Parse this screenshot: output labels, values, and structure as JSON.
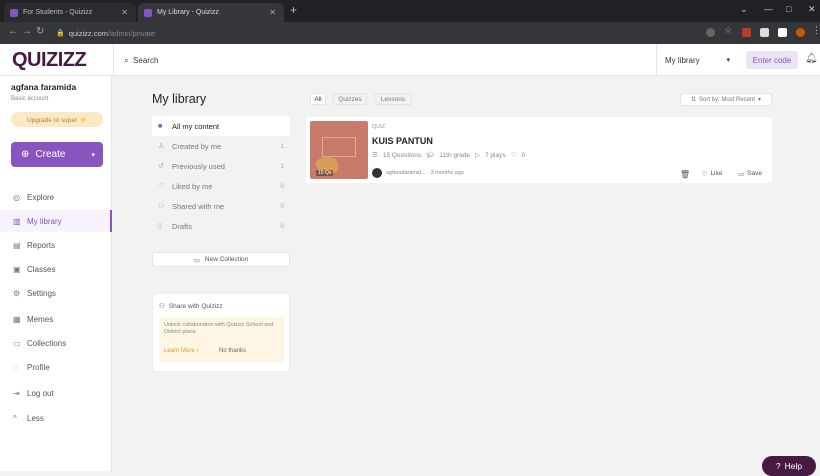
{
  "browser": {
    "tabs": [
      {
        "title": "For Students - Quizizz"
      },
      {
        "title": "My Library - Quizizz"
      }
    ],
    "new_tab": "+",
    "url_host": "quizizz.com",
    "url_path": "/admin/private"
  },
  "header": {
    "logo": "QUIZIZZ",
    "search_placeholder": "Search",
    "library_select": "My library",
    "enter_code": "Enter code"
  },
  "sidebar": {
    "user_name": "agfana faramida",
    "account_type": "Basic account",
    "upgrade": "Upgrade to super ⚡",
    "create": "Create",
    "items": [
      {
        "label": "Explore"
      },
      {
        "label": "My library"
      },
      {
        "label": "Reports"
      },
      {
        "label": "Classes"
      },
      {
        "label": "Settings"
      },
      {
        "label": "Memes"
      },
      {
        "label": "Collections"
      },
      {
        "label": "Profile"
      },
      {
        "label": "Log out"
      },
      {
        "label": "Less"
      }
    ]
  },
  "library": {
    "title": "My library",
    "menu": [
      {
        "label": "All my content",
        "count": ""
      },
      {
        "label": "Created by me",
        "count": "1"
      },
      {
        "label": "Previously used",
        "count": "1"
      },
      {
        "label": "Liked by me",
        "count": "0"
      },
      {
        "label": "Shared with me",
        "count": "0"
      },
      {
        "label": "Drafts",
        "count": "0"
      }
    ],
    "new_collection": "New Collection",
    "share": {
      "title": "Share with Quizizz",
      "text": "Unlock collaboration with Quizizz School and District plans.",
      "learn_more": "Learn More",
      "no_thanks": "No thanks"
    }
  },
  "filters": {
    "tabs": [
      "All",
      "Quizzes",
      "Lessons"
    ],
    "sort": "Sort by: Most Recent"
  },
  "quiz": {
    "type": "QUIZ",
    "title": "KUIS PANTUN",
    "questions": "15 Questions",
    "grade": "11th grade",
    "plays": "7 plays",
    "likes": "0",
    "author": "agfanafaramid...",
    "time": "3 months ago",
    "thumb_label": "15 Qs",
    "like_label": "Like",
    "save_label": "Save"
  },
  "help": "Help",
  "colors": {
    "brand": "#461a42",
    "accent": "#8854c0"
  }
}
